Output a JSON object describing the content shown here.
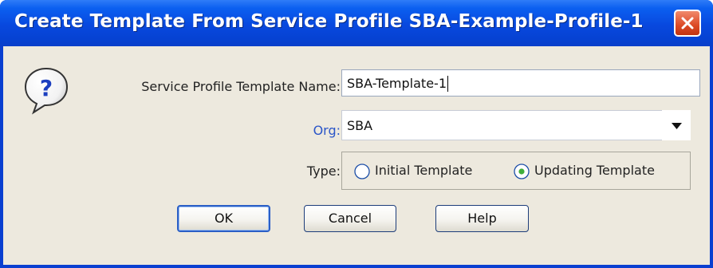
{
  "window": {
    "title": "Create Template From Service Profile SBA-Example-Profile-1"
  },
  "icons": {
    "help": "question-bubble-icon",
    "close": "close-x-icon",
    "dropdown": "triangle-down-icon"
  },
  "form": {
    "name_label": "Service Profile Template Name:",
    "name_value": "SBA-Template-1",
    "org_label": "Org:",
    "org_value": "SBA",
    "type_label": "Type:",
    "type_options": [
      {
        "label": "Initial Template",
        "selected": false
      },
      {
        "label": "Updating Template",
        "selected": true
      }
    ]
  },
  "buttons": {
    "ok": "OK",
    "cancel": "Cancel",
    "help": "Help"
  },
  "colors": {
    "titlebar": "#0848de",
    "org_label": "#2b56c8",
    "panel": "#ede9de",
    "close": "#dc4a26"
  }
}
